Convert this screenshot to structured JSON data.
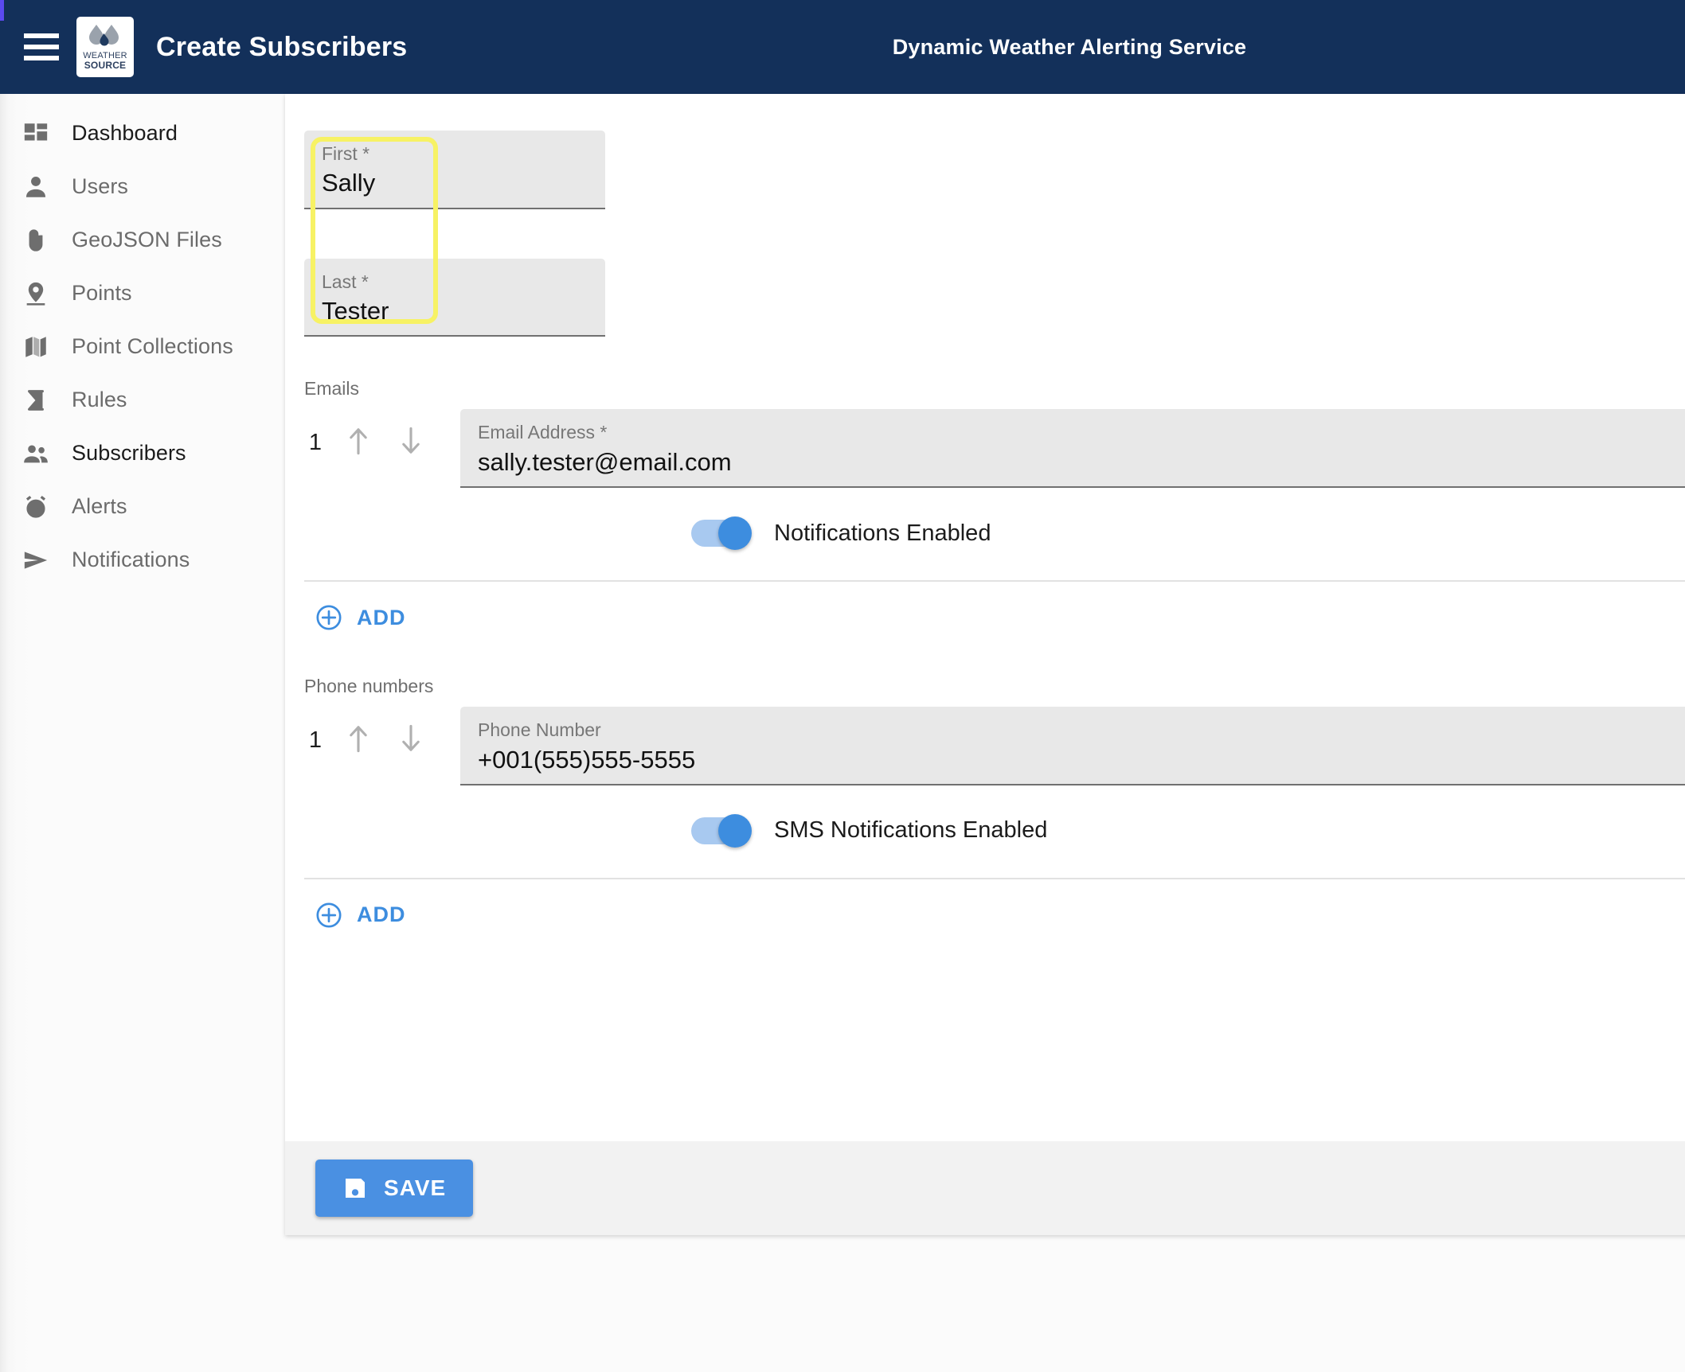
{
  "header": {
    "menu_icon": "hamburger-icon",
    "logo_line1": "WEATHER",
    "logo_line2": "SOURCE",
    "page_title": "Create Subscribers",
    "app_title": "Dynamic Weather Alerting Service",
    "background_color": "#13305a"
  },
  "sidebar": {
    "items": [
      {
        "label": "Dashboard",
        "icon": "dashboard-icon",
        "active": true
      },
      {
        "label": "Users",
        "icon": "person-icon",
        "active": false
      },
      {
        "label": "GeoJSON Files",
        "icon": "paperclip-icon",
        "active": false
      },
      {
        "label": "Points",
        "icon": "map-pin-icon",
        "active": false
      },
      {
        "label": "Point Collections",
        "icon": "map-icon",
        "active": false
      },
      {
        "label": "Rules",
        "icon": "sigma-icon",
        "active": false
      },
      {
        "label": "Subscribers",
        "icon": "people-icon",
        "active": true
      },
      {
        "label": "Alerts",
        "icon": "alarm-clock-icon",
        "active": false
      },
      {
        "label": "Notifications",
        "icon": "send-icon",
        "active": false
      }
    ]
  },
  "form": {
    "first_name": {
      "label": "First *",
      "value": "Sally"
    },
    "last_name": {
      "label": "Last *",
      "value": "Tester"
    },
    "highlight_color": "#f7f264",
    "emails": {
      "section_label": "Emails",
      "rows": [
        {
          "index": "1",
          "field_label": "Email Address *",
          "value": "sally.tester@email.com",
          "toggle_label": "Notifications Enabled",
          "toggle_on": true
        }
      ],
      "add_label": "ADD"
    },
    "phones": {
      "section_label": "Phone numbers",
      "rows": [
        {
          "index": "1",
          "field_label": "Phone Number",
          "value": "+001(555)555-5555",
          "toggle_label": "SMS Notifications Enabled",
          "toggle_on": true
        }
      ],
      "add_label": "ADD"
    },
    "save_label": "SAVE",
    "accent_color": "#4a90e2"
  }
}
